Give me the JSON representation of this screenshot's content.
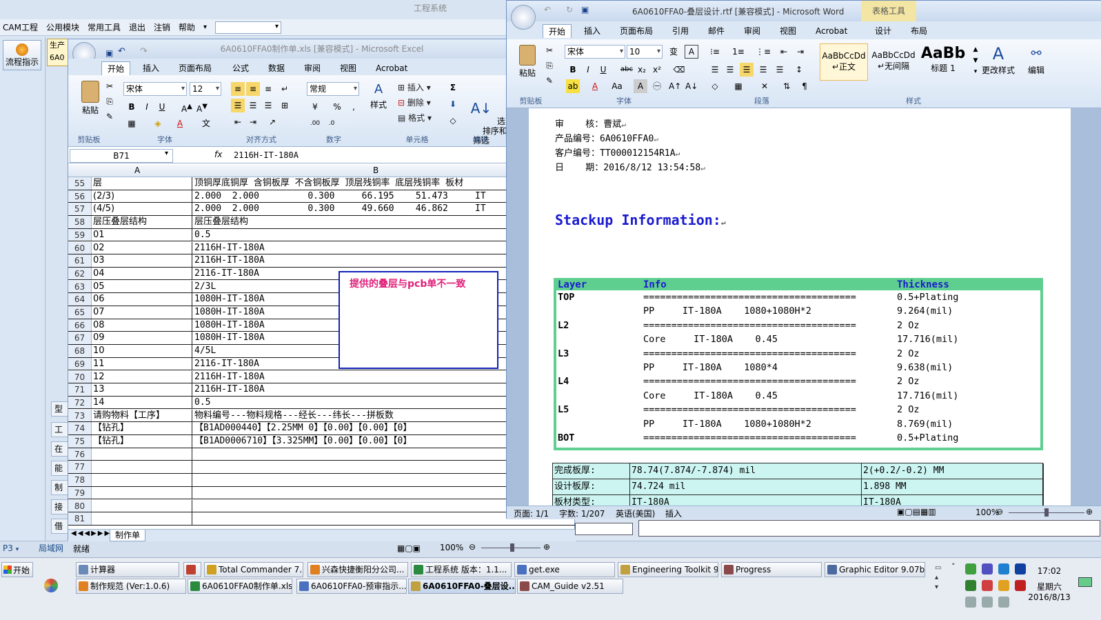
{
  "cam": {
    "title": "工程系统",
    "menu": [
      "CAM工程",
      "公用模块",
      "常用工具",
      "退出",
      "注销",
      "帮助"
    ],
    "flow_button": "流程指示",
    "tab_label": "生产",
    "tab_value": "6A0",
    "side_buttons": [
      "型",
      "工",
      "在",
      "能",
      "制",
      "接",
      "借"
    ],
    "status_cell": "P3",
    "status_lan": "局域网"
  },
  "excel": {
    "title": "6A0610FFA0制作单.xls  [兼容模式] - Microsoft Excel",
    "tabs": [
      "开始",
      "插入",
      "页面布局",
      "公式",
      "数据",
      "审阅",
      "视图",
      "Acrobat"
    ],
    "ribbon": {
      "paste": "粘贴",
      "font_name": "宋体",
      "font_size": "12",
      "number_format": "常规",
      "style": "样式",
      "insert": "插入",
      "delete": "删除",
      "format": "格式",
      "sort_filter": "排序和\n筛选",
      "find": "查\n选",
      "groups": [
        "剪贴板",
        "字体",
        "对齐方式",
        "数字",
        "单元格",
        "编辑"
      ]
    },
    "name_box": "B71",
    "formula": "2116H-IT-180A",
    "col_headers": [
      "A",
      "B"
    ],
    "rows": [
      {
        "n": "55",
        "a": "层",
        "b": "顶铜厚底铜厚 含铜板厚 不含铜板厚 顶层残铜率 底层残铜率 板材"
      },
      {
        "n": "56",
        "a": "(2/3)",
        "b": "2.000  2.000         0.300     66.195    51.473     IT"
      },
      {
        "n": "57",
        "a": "(4/5)",
        "b": "2.000  2.000         0.300     49.660    46.862     IT"
      },
      {
        "n": "58",
        "a": "层压叠层结构",
        "b": "层压叠层结构"
      },
      {
        "n": "59",
        "a": "01",
        "b": "0.5"
      },
      {
        "n": "60",
        "a": "02",
        "b": "2116H-IT-180A"
      },
      {
        "n": "61",
        "a": "03",
        "b": "2116H-IT-180A"
      },
      {
        "n": "62",
        "a": "04",
        "b": "2116-IT-180A"
      },
      {
        "n": "63",
        "a": "05",
        "b": "2/3L"
      },
      {
        "n": "64",
        "a": "06",
        "b": "1080H-IT-180A"
      },
      {
        "n": "65",
        "a": "07",
        "b": "1080H-IT-180A"
      },
      {
        "n": "66",
        "a": "08",
        "b": "1080H-IT-180A"
      },
      {
        "n": "67",
        "a": "09",
        "b": "1080H-IT-180A"
      },
      {
        "n": "68",
        "a": "10",
        "b": "4/5L"
      },
      {
        "n": "69",
        "a": "11",
        "b": "2116-IT-180A"
      },
      {
        "n": "70",
        "a": "12",
        "b": "2116H-IT-180A"
      },
      {
        "n": "71",
        "a": "13",
        "b": "2116H-IT-180A"
      },
      {
        "n": "72",
        "a": "14",
        "b": "0.5"
      },
      {
        "n": "73",
        "a": "请购物料【工序】",
        "b": "物料编号---物料规格---经长---纬长---拼板数"
      },
      {
        "n": "74",
        "a": "【钻孔】",
        "b": "【B1AD000440】【2.25MM 0】【0.00】【0.00】【0】"
      },
      {
        "n": "75",
        "a": "【钻孔】",
        "b": "【B1AD0006710】【3.325MM】【0.00】【0.00】【0】"
      },
      {
        "n": "76",
        "a": "",
        "b": ""
      },
      {
        "n": "77",
        "a": "",
        "b": ""
      },
      {
        "n": "78",
        "a": "",
        "b": ""
      },
      {
        "n": "79",
        "a": "",
        "b": ""
      },
      {
        "n": "80",
        "a": "",
        "b": ""
      },
      {
        "n": "81",
        "a": "",
        "b": ""
      }
    ],
    "note": "提供的叠层与pcb单不一致",
    "sheet_tab": "制作单",
    "status_ready": "就绪",
    "zoom": "100%"
  },
  "word": {
    "title": "6A0610FFA0-叠层设计.rtf [兼容模式] - Microsoft Word",
    "context_tab": "表格工具",
    "tabs": [
      "开始",
      "插入",
      "页面布局",
      "引用",
      "邮件",
      "审阅",
      "视图",
      "Acrobat",
      "设计",
      "布局"
    ],
    "ribbon": {
      "paste": "粘贴",
      "font_name": "宋体",
      "font_size": "10",
      "styles": [
        {
          "preview": "AaBbCcDd",
          "label": "↵正文"
        },
        {
          "preview": "AaBbCcDd",
          "label": "↵无间隔"
        },
        {
          "preview": "AaBb",
          "label": "标题 1"
        }
      ],
      "change_styles": "更改样式",
      "edit": "编辑",
      "groups": [
        "剪贴板",
        "字体",
        "段落",
        "样式"
      ]
    },
    "header_lines": [
      "审    核：曹斌",
      "产品编号：6A0610FFA0",
      "客户编号：TT000012154R1A",
      "日    期：2016/8/12 13:54:58"
    ],
    "stackup_title": "Stackup Information:",
    "stackup_headers": [
      "Layer",
      "Info",
      "Thickness"
    ],
    "stackup_rows": [
      {
        "layer": "TOP",
        "info": "======================================",
        "thk": "0.5+Plating"
      },
      {
        "layer": "",
        "info": "PP     IT-180A    1080+1080H*2",
        "thk": "9.264(mil)"
      },
      {
        "layer": "L2",
        "info": "======================================",
        "thk": "2 Oz"
      },
      {
        "layer": "",
        "info": "Core     IT-180A    0.45",
        "thk": "17.716(mil)"
      },
      {
        "layer": "L3",
        "info": "======================================",
        "thk": "2 Oz"
      },
      {
        "layer": "",
        "info": "PP     IT-180A    1080*4",
        "thk": "9.638(mil)"
      },
      {
        "layer": "L4",
        "info": "======================================",
        "thk": "2 Oz"
      },
      {
        "layer": "",
        "info": "Core     IT-180A    0.45",
        "thk": "17.716(mil)"
      },
      {
        "layer": "L5",
        "info": "======================================",
        "thk": "2 Oz"
      },
      {
        "layer": "",
        "info": "PP     IT-180A    1080+1080H*2",
        "thk": "8.769(mil)"
      },
      {
        "layer": "BOT",
        "info": "======================================",
        "thk": "0.5+Plating"
      }
    ],
    "thickness_rows": [
      {
        "label": "完成板厚:",
        "v1": "78.74(7.874/-7.874) mil",
        "v2": "2(+0.2/-0.2) MM"
      },
      {
        "label": "设计板厚:",
        "v1": "74.724 mil",
        "v2": "1.898 MM"
      },
      {
        "label": "板材类型:",
        "v1": "IT-180A",
        "v2": "IT-180A"
      }
    ],
    "status": {
      "page": "页面: 1/1",
      "words": "字数: 1/207",
      "lang": "英语(美国)",
      "mode": "插入",
      "zoom": "100%"
    }
  },
  "taskbar": {
    "start": "开始",
    "row1": [
      "计算器",
      "",
      "Total Commander 7.0 ...",
      "兴森快捷衡阳分公司...",
      "工程系统  版本：1.1...",
      "get.exe",
      "Engineering Toolkit 9.0...",
      "Progress",
      "Graphic Editor 9.07b2 ..."
    ],
    "row2": [
      "制作规范 (Ver:1.0.6)",
      "6A0610FFA0制作单.xls ...",
      "6A0610FFA0-预审指示...",
      "6A0610FFA0-叠层设...",
      "CAM_Guide v2.51"
    ],
    "time": "17:02",
    "weekday": "星期六",
    "date": "2016/8/13"
  }
}
